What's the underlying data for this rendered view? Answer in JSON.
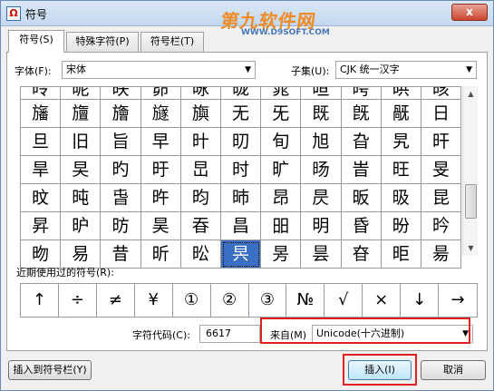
{
  "window": {
    "title": "符号",
    "icon_glyph": "Ω",
    "close_label": "x"
  },
  "watermark": {
    "logo": "第九软件网",
    "url": "WWW.D9SOFT.COM"
  },
  "tabs": [
    "符号(S)",
    "特殊字符(P)",
    "符号栏(T)"
  ],
  "font": {
    "label": "字体(F):",
    "value": "宋体"
  },
  "subset": {
    "label": "子集(U):",
    "value": "CJK 统一汉字"
  },
  "grid": {
    "cut_row": [
      "昤",
      "昵",
      "昳",
      "昴",
      "昹",
      "昽",
      "晁",
      "晅",
      "晇",
      "晎",
      "晐"
    ],
    "rows": [
      [
        "旛",
        "旜",
        "旝",
        "旞",
        "旟",
        "无",
        "旡",
        "既",
        "旣",
        "旤",
        "日"
      ],
      [
        "旦",
        "旧",
        "旨",
        "早",
        "旪",
        "旫",
        "旬",
        "旭",
        "旮",
        "旯",
        "旰"
      ],
      [
        "旱",
        "旲",
        "旳",
        "旴",
        "旵",
        "时",
        "旷",
        "旸",
        "旹",
        "旺",
        "旻"
      ],
      [
        "旼",
        "旽",
        "旾",
        "旿",
        "昀",
        "昁",
        "昂",
        "昃",
        "昄",
        "昅",
        "昆"
      ],
      [
        "昇",
        "昈",
        "昉",
        "昊",
        "昋",
        "昌",
        "昍",
        "明",
        "昏",
        "昐",
        "昑"
      ],
      [
        "昒",
        "易",
        "昔",
        "昕",
        "昖",
        "昗",
        "昘",
        "昙",
        "昚",
        "昛",
        "昜"
      ]
    ],
    "selected": "昗"
  },
  "recent": {
    "label": "近期使用过的符号(R):",
    "items": [
      "↑",
      "÷",
      "≠",
      "¥",
      "①",
      "②",
      "③",
      "№",
      "√",
      "×",
      "↓",
      "→",
      "↑",
      "←"
    ]
  },
  "code": {
    "label": "字符代码(C):",
    "value": "6617"
  },
  "from": {
    "label": "来自(M)",
    "value": "Unicode(十六进制)"
  },
  "buttons": {
    "insert_to_bar": "插入到符号栏(Y)",
    "insert": "插入(I)",
    "cancel": "取消"
  }
}
